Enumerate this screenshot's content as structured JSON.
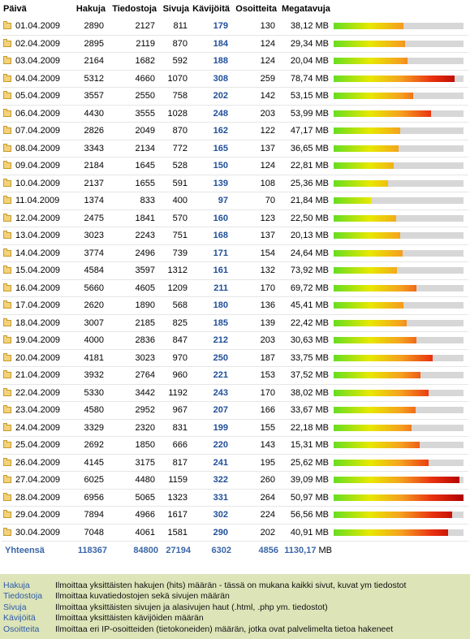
{
  "header": {
    "date": "Päivä",
    "hits": "Hakuja",
    "files": "Tiedostoja",
    "pages": "Sivuja",
    "visits": "Kävijöitä",
    "hosts": "Osoitteita",
    "bandwidth": "Megatavuja"
  },
  "rows": [
    {
      "date": "01.04.2009",
      "hits": "2890",
      "files": "2127",
      "pages": "811",
      "visits": "179",
      "hosts": "130",
      "mb": "38,12 MB",
      "bar": 0.54
    },
    {
      "date": "02.04.2009",
      "hits": "2895",
      "files": "2119",
      "pages": "870",
      "visits": "184",
      "hosts": "124",
      "mb": "29,34 MB",
      "bar": 0.55
    },
    {
      "date": "03.04.2009",
      "hits": "2164",
      "files": "1682",
      "pages": "592",
      "visits": "188",
      "hosts": "124",
      "mb": "20,04 MB",
      "bar": 0.57
    },
    {
      "date": "04.04.2009",
      "hits": "5312",
      "files": "4660",
      "pages": "1070",
      "visits": "308",
      "hosts": "259",
      "mb": "78,74 MB",
      "bar": 0.93
    },
    {
      "date": "05.04.2009",
      "hits": "3557",
      "files": "2550",
      "pages": "758",
      "visits": "202",
      "hosts": "142",
      "mb": "53,15 MB",
      "bar": 0.61
    },
    {
      "date": "06.04.2009",
      "hits": "4430",
      "files": "3555",
      "pages": "1028",
      "visits": "248",
      "hosts": "203",
      "mb": "53,99 MB",
      "bar": 0.75
    },
    {
      "date": "07.04.2009",
      "hits": "2826",
      "files": "2049",
      "pages": "870",
      "visits": "162",
      "hosts": "122",
      "mb": "47,17 MB",
      "bar": 0.51
    },
    {
      "date": "08.04.2009",
      "hits": "3343",
      "files": "2134",
      "pages": "772",
      "visits": "165",
      "hosts": "137",
      "mb": "36,65 MB",
      "bar": 0.5
    },
    {
      "date": "09.04.2009",
      "hits": "2184",
      "files": "1645",
      "pages": "528",
      "visits": "150",
      "hosts": "124",
      "mb": "22,81 MB",
      "bar": 0.46
    },
    {
      "date": "10.04.2009",
      "hits": "2137",
      "files": "1655",
      "pages": "591",
      "visits": "139",
      "hosts": "108",
      "mb": "25,36 MB",
      "bar": 0.42
    },
    {
      "date": "11.04.2009",
      "hits": "1374",
      "files": "833",
      "pages": "400",
      "visits": "97",
      "hosts": "70",
      "mb": "21,84 MB",
      "bar": 0.29
    },
    {
      "date": "12.04.2009",
      "hits": "2475",
      "files": "1841",
      "pages": "570",
      "visits": "160",
      "hosts": "123",
      "mb": "22,50 MB",
      "bar": 0.48
    },
    {
      "date": "13.04.2009",
      "hits": "3023",
      "files": "2243",
      "pages": "751",
      "visits": "168",
      "hosts": "137",
      "mb": "20,13 MB",
      "bar": 0.51
    },
    {
      "date": "14.04.2009",
      "hits": "3774",
      "files": "2496",
      "pages": "739",
      "visits": "171",
      "hosts": "154",
      "mb": "24,64 MB",
      "bar": 0.53
    },
    {
      "date": "15.04.2009",
      "hits": "4584",
      "files": "3597",
      "pages": "1312",
      "visits": "161",
      "hosts": "132",
      "mb": "73,92 MB",
      "bar": 0.49
    },
    {
      "date": "16.04.2009",
      "hits": "5660",
      "files": "4605",
      "pages": "1209",
      "visits": "211",
      "hosts": "170",
      "mb": "69,72 MB",
      "bar": 0.64
    },
    {
      "date": "17.04.2009",
      "hits": "2620",
      "files": "1890",
      "pages": "568",
      "visits": "180",
      "hosts": "136",
      "mb": "45,41 MB",
      "bar": 0.54
    },
    {
      "date": "18.04.2009",
      "hits": "3007",
      "files": "2185",
      "pages": "825",
      "visits": "185",
      "hosts": "139",
      "mb": "22,42 MB",
      "bar": 0.56
    },
    {
      "date": "19.04.2009",
      "hits": "4000",
      "files": "2836",
      "pages": "847",
      "visits": "212",
      "hosts": "203",
      "mb": "30,63 MB",
      "bar": 0.64
    },
    {
      "date": "20.04.2009",
      "hits": "4181",
      "files": "3023",
      "pages": "970",
      "visits": "250",
      "hosts": "187",
      "mb": "33,75 MB",
      "bar": 0.76
    },
    {
      "date": "21.04.2009",
      "hits": "3932",
      "files": "2764",
      "pages": "960",
      "visits": "221",
      "hosts": "153",
      "mb": "37,52 MB",
      "bar": 0.67
    },
    {
      "date": "22.04.2009",
      "hits": "5330",
      "files": "3442",
      "pages": "1192",
      "visits": "243",
      "hosts": "170",
      "mb": "38,02 MB",
      "bar": 0.73
    },
    {
      "date": "23.04.2009",
      "hits": "4580",
      "files": "2952",
      "pages": "967",
      "visits": "207",
      "hosts": "166",
      "mb": "33,67 MB",
      "bar": 0.63
    },
    {
      "date": "24.04.2009",
      "hits": "3329",
      "files": "2320",
      "pages": "831",
      "visits": "199",
      "hosts": "155",
      "mb": "22,18 MB",
      "bar": 0.6
    },
    {
      "date": "25.04.2009",
      "hits": "2692",
      "files": "1850",
      "pages": "666",
      "visits": "220",
      "hosts": "143",
      "mb": "15,31 MB",
      "bar": 0.66
    },
    {
      "date": "26.04.2009",
      "hits": "4145",
      "files": "3175",
      "pages": "817",
      "visits": "241",
      "hosts": "195",
      "mb": "25,62 MB",
      "bar": 0.73
    },
    {
      "date": "27.04.2009",
      "hits": "6025",
      "files": "4480",
      "pages": "1159",
      "visits": "322",
      "hosts": "260",
      "mb": "39,09 MB",
      "bar": 0.97
    },
    {
      "date": "28.04.2009",
      "hits": "6956",
      "files": "5065",
      "pages": "1323",
      "visits": "331",
      "hosts": "264",
      "mb": "50,97 MB",
      "bar": 1.0
    },
    {
      "date": "29.04.2009",
      "hits": "7894",
      "files": "4966",
      "pages": "1617",
      "visits": "302",
      "hosts": "224",
      "mb": "56,56 MB",
      "bar": 0.91
    },
    {
      "date": "30.04.2009",
      "hits": "7048",
      "files": "4061",
      "pages": "1581",
      "visits": "290",
      "hosts": "202",
      "mb": "40,91 MB",
      "bar": 0.88
    }
  ],
  "totals": {
    "label": "Yhteensä",
    "hits": "118367",
    "files": "84800",
    "pages": "27194",
    "visits": "6302",
    "hosts": "4856",
    "mb_value": "1130,17",
    "mb_unit": "MB"
  },
  "legend": [
    {
      "term": "Hakuja",
      "desc": "Ilmoittaa yksittäisten hakujen (hits) määrän - tässä on mukana kaikki sivut, kuvat ym tiedostot"
    },
    {
      "term": "Tiedostoja",
      "desc": "Ilmoittaa kuvatiedostojen sekä sivujen määrän"
    },
    {
      "term": "Sivuja",
      "desc": "Ilmoittaa yksittäisten sivujen ja alasivujen haut (.html, .php ym. tiedostot)"
    },
    {
      "term": "Kävijöitä",
      "desc": "Ilmoittaa yksittäisten kävijöiden määrän"
    },
    {
      "term": "Osoitteita",
      "desc": "Ilmoittaa eri IP-osoitteiden (tietokoneiden) määrän, jotka ovat palvelimelta tietoa hakeneet"
    }
  ],
  "colors": {
    "visits_text": "#1f4e99",
    "totals_text": "#3a66a8",
    "legend_bg": "#dde4b8",
    "bar_track": "#d7d7d7"
  }
}
